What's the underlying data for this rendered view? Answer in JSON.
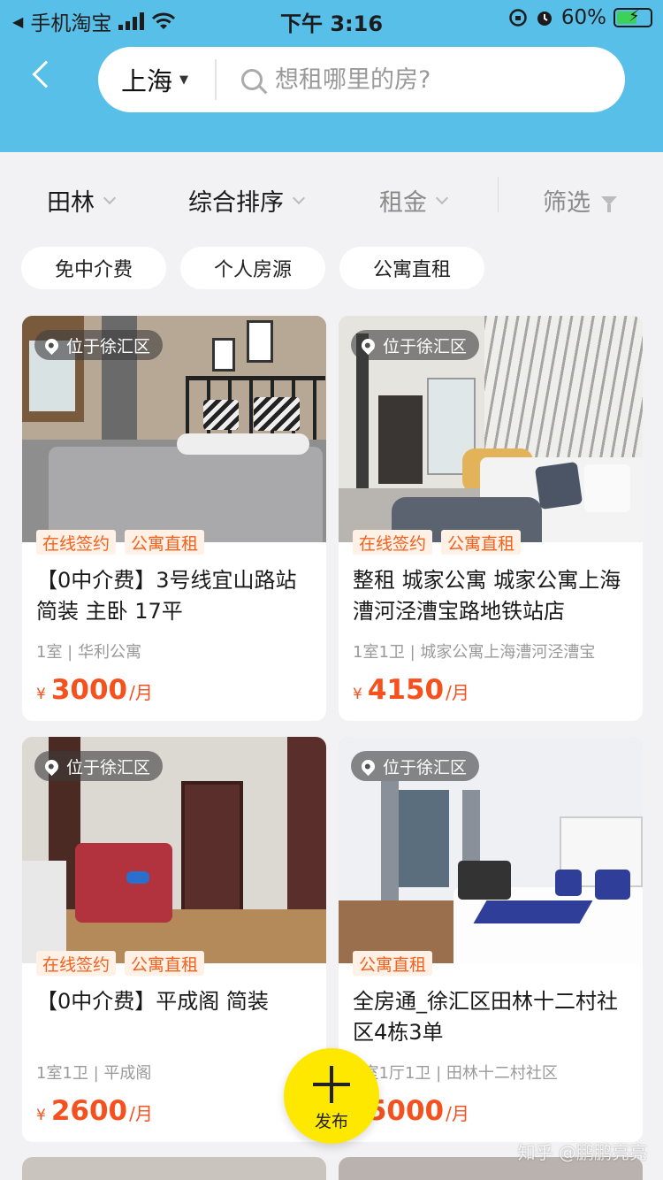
{
  "status_bar": {
    "back_app": "手机淘宝",
    "time": "下午 3:16",
    "battery": "60%"
  },
  "search": {
    "city": "上海",
    "placeholder": "想租哪里的房?"
  },
  "filters": {
    "area": "田林",
    "sort": "综合排序",
    "rent": "租金",
    "screen": "筛选"
  },
  "tags": [
    "免中介费",
    "个人房源",
    "公寓直租"
  ],
  "listings": [
    {
      "location": "位于徐汇区",
      "badges": [
        "在线签约",
        "公寓直租"
      ],
      "title": "【0中介费】3号线宜山路站 简装 主卧 17平",
      "meta": "1室 | 华利公寓",
      "currency": "¥",
      "price": "3000",
      "unit": "/月"
    },
    {
      "location": "位于徐汇区",
      "badges": [
        "在线签约",
        "公寓直租"
      ],
      "title": "整租 城家公寓 城家公寓上海漕河泾漕宝路地铁站店",
      "meta": "1室1卫 | 城家公寓上海漕河泾漕宝",
      "currency": "¥",
      "price": "4150",
      "unit": "/月"
    },
    {
      "location": "位于徐汇区",
      "badges": [
        "在线签约",
        "公寓直租"
      ],
      "title": "【0中介费】平成阁 简装",
      "meta": "1室1卫 | 平成阁",
      "currency": "¥",
      "price": "2600",
      "unit": "/月"
    },
    {
      "location": "位于徐汇区",
      "badges": [
        "公寓直租"
      ],
      "title": "全房通_徐汇区田林十二村社区4栋3单",
      "meta": "1室1厅1卫 | 田林十二村社区",
      "currency": "¥",
      "price": "5000",
      "unit": "/月"
    }
  ],
  "fab": {
    "label": "发布"
  },
  "watermark": "知乎 @鹏鹏亮亮"
}
